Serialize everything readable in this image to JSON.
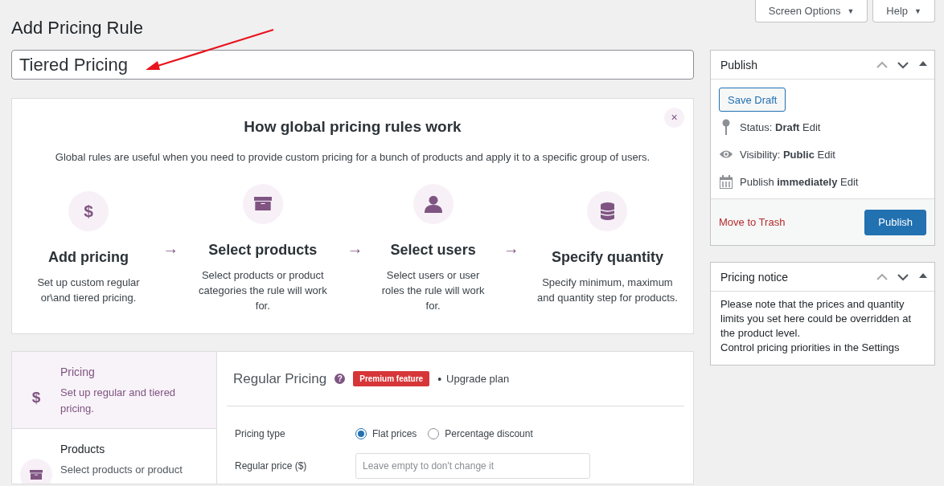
{
  "header_buttons": [
    {
      "label": "Screen Options",
      "caret": "▼"
    },
    {
      "label": "Help",
      "caret": "▼"
    }
  ],
  "page_title": "Add Pricing Rule",
  "title_field": {
    "value": "Tiered Pricing"
  },
  "annotation": {
    "kind": "arrow"
  },
  "guide": {
    "close": "×",
    "title": "How global pricing rules work",
    "description": "Global rules are useful when you need to provide custom pricing for a bunch of products and apply it to a specific group of users.",
    "arrow": "→",
    "steps": [
      {
        "glyph": "$",
        "title": "Add pricing",
        "text": "Set up custom regular or\\and tiered pricing."
      },
      {
        "title": "Select products",
        "text": "Select products or product categories the rule will work for."
      },
      {
        "title": "Select users",
        "text": "Select users or user roles the rule will work for."
      },
      {
        "title": "Specify quantity",
        "text": "Specify minimum, maximum and quantity step for products."
      }
    ]
  },
  "editor": {
    "tabs": [
      {
        "glyph": "$",
        "label": "Pricing",
        "description": "Set up regular and tiered pricing.",
        "selected": true
      },
      {
        "label": "Products",
        "description": "Select products or product",
        "selected": false
      }
    ],
    "section_title": "Regular Pricing",
    "help_icon": "?",
    "badge": "Premium feature",
    "separator": "•",
    "upgrade": "Upgrade plan",
    "fields": [
      {
        "kind": "radio",
        "label": "Pricing type",
        "options": [
          {
            "label": "Flat prices",
            "selected": true
          },
          {
            "label": "Percentage discount",
            "selected": false
          }
        ]
      },
      {
        "kind": "text",
        "label": "Regular price ($)",
        "placeholder": "Leave empty to don't change it"
      }
    ]
  },
  "publish_box": {
    "title": "Publish",
    "save_draft": "Save Draft",
    "meta": [
      {
        "text": "Status: **Draft** Edit"
      },
      {
        "text": "Visibility: **Public** Edit"
      },
      {
        "text": "Publish **immediately** Edit"
      }
    ],
    "trash": "Move to Trash",
    "publish": "Publish"
  },
  "notice_box": {
    "title": "Pricing notice",
    "paragraphs": [
      "Please note that the prices and quantity limits you set here could be overridden at the product level.",
      "Control pricing priorities in the Settings"
    ]
  }
}
